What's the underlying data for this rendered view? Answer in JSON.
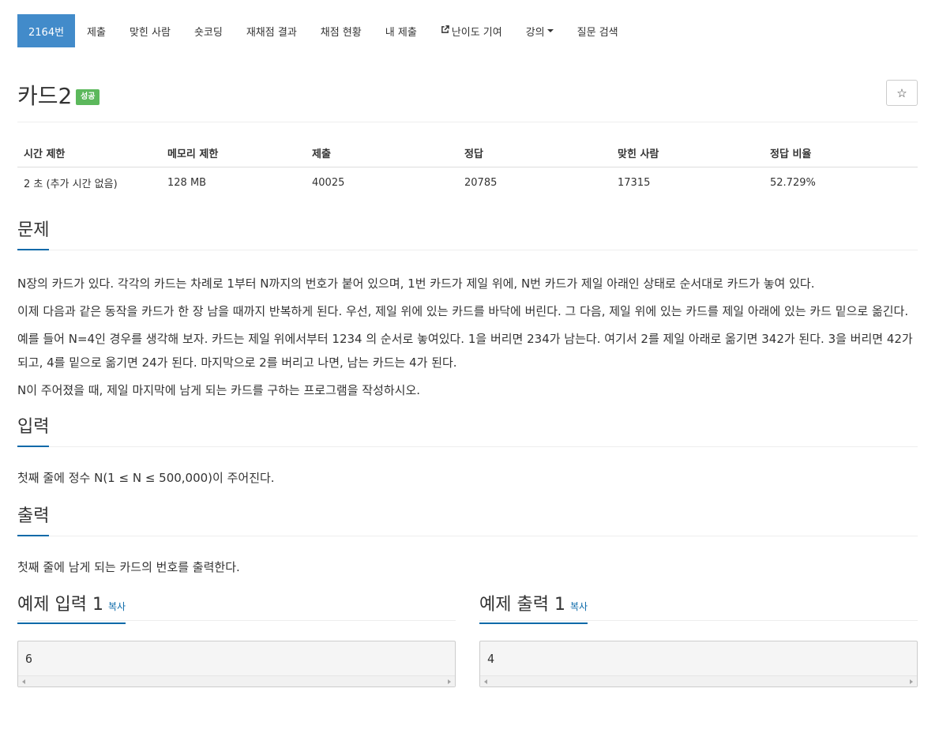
{
  "nav": {
    "items": [
      {
        "label": "2164번"
      },
      {
        "label": "제출"
      },
      {
        "label": "맞힌 사람"
      },
      {
        "label": "숏코딩"
      },
      {
        "label": "재채점 결과"
      },
      {
        "label": "채점 현황"
      },
      {
        "label": "내 제출"
      },
      {
        "label": "난이도 기여"
      },
      {
        "label": "강의"
      },
      {
        "label": "질문 검색"
      }
    ]
  },
  "problem": {
    "title": "카드2",
    "badge": "성공",
    "star_icon": "☆"
  },
  "info": {
    "headers": [
      "시간 제한",
      "메모리 제한",
      "제출",
      "정답",
      "맞힌 사람",
      "정답 비율"
    ],
    "values": [
      "2 초 (추가 시간 없음)",
      "128 MB",
      "40025",
      "20785",
      "17315",
      "52.729%"
    ]
  },
  "description": {
    "heading": "문제",
    "paragraphs": [
      "N장의 카드가 있다. 각각의 카드는 차례로 1부터 N까지의 번호가 붙어 있으며, 1번 카드가 제일 위에, N번 카드가 제일 아래인 상태로 순서대로 카드가 놓여 있다.",
      "이제 다음과 같은 동작을 카드가 한 장 남을 때까지 반복하게 된다. 우선, 제일 위에 있는 카드를 바닥에 버린다. 그 다음, 제일 위에 있는 카드를 제일 아래에 있는 카드 밑으로 옮긴다.",
      "예를 들어 N=4인 경우를 생각해 보자. 카드는 제일 위에서부터 1234 의 순서로 놓여있다. 1을 버리면 234가 남는다. 여기서 2를 제일 아래로 옮기면 342가 된다. 3을 버리면 42가 되고, 4를 밑으로 옮기면 24가 된다. 마지막으로 2를 버리고 나면, 남는 카드는 4가 된다.",
      "N이 주어졌을 때, 제일 마지막에 남게 되는 카드를 구하는 프로그램을 작성하시오."
    ]
  },
  "input": {
    "heading": "입력",
    "text": "첫째 줄에 정수 N(1 ≤ N ≤ 500,000)이 주어진다."
  },
  "output": {
    "heading": "출력",
    "text": "첫째 줄에 남게 되는 카드의 번호를 출력한다."
  },
  "samples": {
    "input_heading": "예제 입력 1",
    "output_heading": "예제 출력 1",
    "copy_label": "복사",
    "input_value": "6",
    "output_value": "4"
  }
}
